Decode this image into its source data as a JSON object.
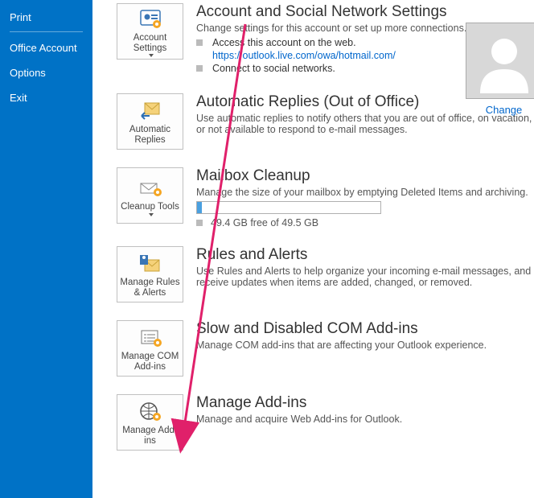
{
  "sidebar": {
    "items": [
      {
        "label": "Print"
      },
      {
        "label": "Office Account"
      },
      {
        "label": "Options"
      },
      {
        "label": "Exit"
      }
    ]
  },
  "avatar": {
    "change": "Change"
  },
  "sections": {
    "account": {
      "tile": "Account Settings",
      "title": "Account and Social Network Settings",
      "desc": "Change settings for this account or set up more connections.",
      "b1": "Access this account on the web.",
      "url": "https://outlook.live.com/owa/hotmail.com/",
      "b2": "Connect to social networks."
    },
    "autoreply": {
      "tile": "Automatic Replies",
      "title": "Automatic Replies (Out of Office)",
      "desc": "Use automatic replies to notify others that you are out of office, on vacation, or not available to respond to e-mail messages."
    },
    "cleanup": {
      "tile": "Cleanup Tools",
      "title": "Mailbox Cleanup",
      "desc": "Manage the size of your mailbox by emptying Deleted Items and archiving.",
      "storage": "49.4 GB free of 49.5 GB"
    },
    "rules": {
      "tile": "Manage Rules & Alerts",
      "title": "Rules and Alerts",
      "desc": "Use Rules and Alerts to help organize your incoming e-mail messages, and receive updates when items are added, changed, or removed."
    },
    "com": {
      "tile": "Manage COM Add-ins",
      "title": "Slow and Disabled COM Add-ins",
      "desc": "Manage COM add-ins that are affecting your Outlook experience."
    },
    "addins": {
      "tile": "Manage Add-ins",
      "title": "Manage Add-ins",
      "desc": "Manage and acquire Web Add-ins for Outlook."
    }
  }
}
